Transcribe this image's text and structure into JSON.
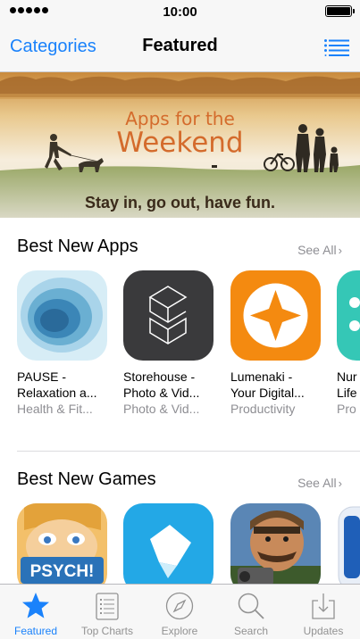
{
  "status_bar": {
    "time": "10:00"
  },
  "nav": {
    "left_label": "Categories",
    "title": "Featured",
    "right_icon": "list-icon"
  },
  "banner": {
    "line1": "Apps for the",
    "line2": "Weekend",
    "tagline": "Stay in, go out, have fun."
  },
  "sections": [
    {
      "title": "Best New Apps",
      "see_all": "See All",
      "apps": [
        {
          "name": "PAUSE -",
          "name2": "Relaxation a...",
          "category": "Health & Fit..."
        },
        {
          "name": "Storehouse -",
          "name2": "Photo & Vid...",
          "category": "Photo & Vid..."
        },
        {
          "name": "Lumenaki -",
          "name2": "Your Digital...",
          "category": "Productivity"
        },
        {
          "name": "Nur",
          "name2": "Life",
          "category": "Pro"
        }
      ]
    },
    {
      "title": "Best New Games",
      "see_all": "See All",
      "apps": [
        {
          "icon_text": "PSYCH!"
        }
      ]
    }
  ],
  "tabs": [
    {
      "label": "Featured",
      "icon": "star-icon",
      "active": true
    },
    {
      "label": "Top Charts",
      "icon": "list-icon",
      "active": false
    },
    {
      "label": "Explore",
      "icon": "compass-icon",
      "active": false
    },
    {
      "label": "Search",
      "icon": "search-icon",
      "active": false
    },
    {
      "label": "Updates",
      "icon": "download-icon",
      "active": false
    }
  ],
  "colors": {
    "accent": "#1a82fb",
    "inactive": "#929292",
    "banner_text": "#d46b2c"
  }
}
